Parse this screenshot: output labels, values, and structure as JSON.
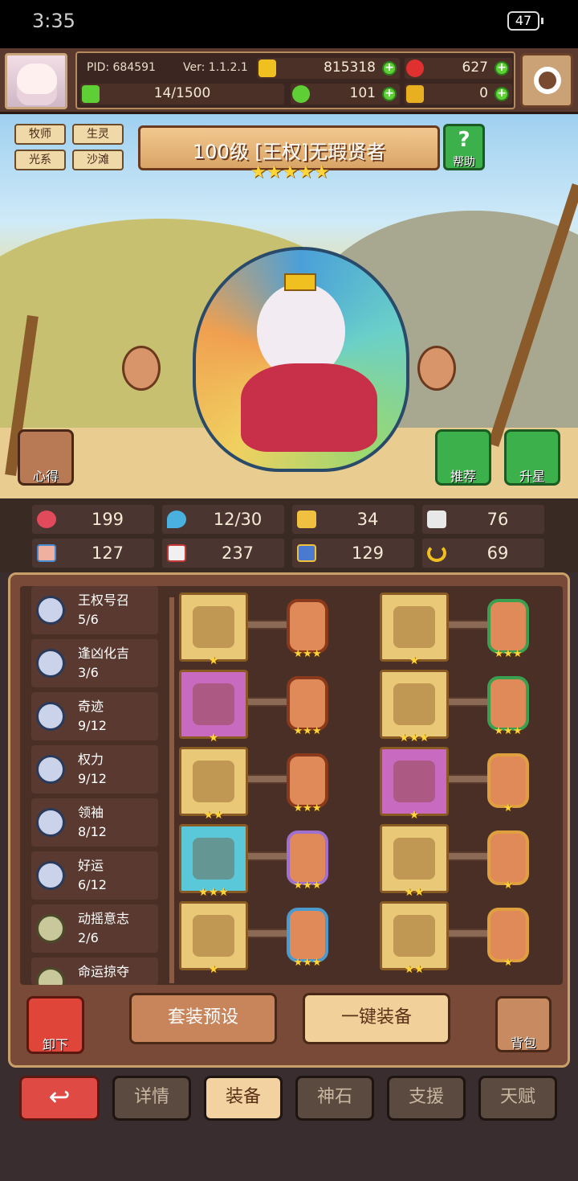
{
  "status": {
    "time": "3:35",
    "battery": "47"
  },
  "header": {
    "pid": "PID: 684591",
    "version": "Ver: 1.1.2.1",
    "exp": "14/1500",
    "gold": "815318",
    "gems": "627",
    "clover": "101",
    "horn": "0"
  },
  "hero": {
    "tags": [
      "牧师",
      "生灵",
      "光系",
      "沙滩"
    ],
    "title": "100级 [王权]无瑕贤者",
    "stars": "★★★★★",
    "help": "帮助",
    "insight": "心得",
    "recommend": "推荐",
    "star_up": "升星"
  },
  "stats": [
    {
      "icon": "heart-icon",
      "value": "199"
    },
    {
      "icon": "water-drop-icon",
      "value": "12/30"
    },
    {
      "icon": "shield-icon",
      "value": "34"
    },
    {
      "icon": "wing-icon",
      "value": "76"
    },
    {
      "icon": "fist-icon",
      "value": "127"
    },
    {
      "icon": "book-icon",
      "value": "237"
    },
    {
      "icon": "boot-icon",
      "value": "129"
    },
    {
      "icon": "horseshoe-icon",
      "value": "69"
    }
  ],
  "sets": [
    {
      "name": "王权号召",
      "progress": "5/6"
    },
    {
      "name": "逢凶化吉",
      "progress": "3/6"
    },
    {
      "name": "奇迹",
      "progress": "9/12"
    },
    {
      "name": "权力",
      "progress": "9/12"
    },
    {
      "name": "领袖",
      "progress": "8/12"
    },
    {
      "name": "好运",
      "progress": "6/12"
    },
    {
      "name": "动摇意志",
      "progress": "2/6"
    },
    {
      "name": "命运掠夺",
      "progress": ""
    }
  ],
  "gear": [
    {
      "bg": "#e9c877",
      "icon": "staff-icon",
      "stars": "★",
      "rune_border": "#8a3a1a",
      "rune_stars": "★★★"
    },
    {
      "bg": "#e9c877",
      "icon": "crown-icon",
      "stars": "★",
      "rune_border": "#3aa050",
      "rune_stars": "★★★"
    },
    {
      "bg": "#c86ac0",
      "icon": "shield-icon",
      "stars": "★",
      "rune_border": "#8a3a1a",
      "rune_stars": "★★★"
    },
    {
      "bg": "#e9c877",
      "icon": "armor-icon",
      "stars": "★★★",
      "rune_border": "#3aa050",
      "rune_stars": "★★★"
    },
    {
      "bg": "#e9c877",
      "icon": "necklace-icon",
      "stars": "★★",
      "rune_border": "#8a3a1a",
      "rune_stars": "★★★"
    },
    {
      "bg": "#c86ac0",
      "icon": "glove-icon",
      "stars": "★",
      "rune_border": "#e0a040",
      "rune_stars": "★"
    },
    {
      "bg": "#5ac8d8",
      "icon": "coin-icon",
      "stars": "★★★",
      "rune_border": "#a070d0",
      "rune_stars": "★★★"
    },
    {
      "bg": "#e9c877",
      "icon": "ring-icon",
      "stars": "★★",
      "rune_border": "#e0a040",
      "rune_stars": "★"
    },
    {
      "bg": "#e9c877",
      "icon": "gem-ring-icon",
      "stars": "★",
      "rune_border": "#4a9ad0",
      "rune_stars": "★★★"
    },
    {
      "bg": "#e9c877",
      "icon": "boots-icon",
      "stars": "★★",
      "rune_border": "#e0a040",
      "rune_stars": "★"
    }
  ],
  "actions": {
    "unequip": "卸下",
    "preset": "套装预设",
    "equip_all": "一键装备",
    "bag": "背包"
  },
  "tabs": [
    "详情",
    "装备",
    "神石",
    "支援",
    "天赋"
  ],
  "colors": {
    "accent": "#3cb04a",
    "panel": "#7a4a38",
    "tab_active": "#f2d2a0",
    "back": "#e04a44"
  }
}
